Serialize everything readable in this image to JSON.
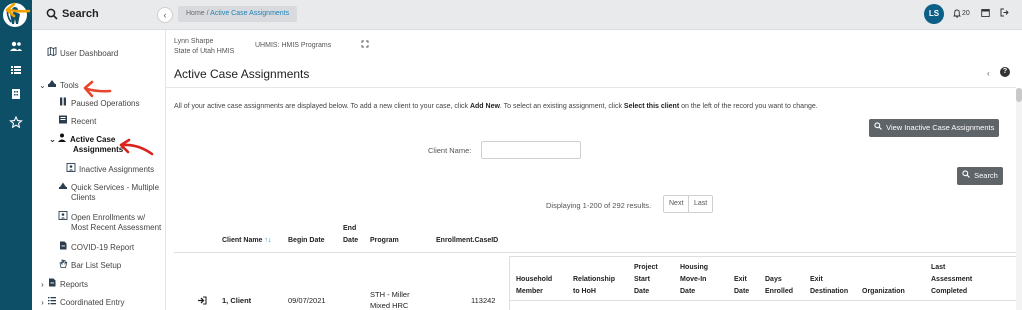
{
  "sidebar": {
    "search_label": "Search",
    "items": [
      {
        "label": "User Dashboard",
        "icon": "map-icon"
      },
      {
        "label": "Tools",
        "icon": "tools-icon",
        "expand": "chevron-down"
      },
      {
        "label": "Paused Operations",
        "icon": "pause-icon"
      },
      {
        "label": "Recent",
        "icon": "recent-icon"
      },
      {
        "label_line1": "Active Case",
        "label_line2": "Assignments",
        "icon": "person-icon",
        "expand": "chevron-down"
      },
      {
        "label": "Inactive Assignments",
        "icon": "user-card-icon"
      },
      {
        "label_line1": "Quick Services - Multiple",
        "label_line2": "Clients",
        "icon": "quick-services-icon"
      },
      {
        "label_line1": "Open Enrollments w/",
        "label_line2": "Most Recent Assessment",
        "icon": "enrollments-icon"
      },
      {
        "label": "COVID-19 Report",
        "icon": "report-icon"
      },
      {
        "label": "Bar List Setup",
        "icon": "hand-icon"
      },
      {
        "label": "Reports",
        "icon": "reports-icon",
        "expand": "chevron-right"
      },
      {
        "label": "Coordinated Entry",
        "icon": "list-icon",
        "expand": "chevron-right"
      }
    ]
  },
  "topbar": {
    "breadcrumb_home": "Home",
    "breadcrumb_sep": "/",
    "breadcrumb_current": "Active Case Assignments",
    "avatar_initials": "LS",
    "notification_count": "20"
  },
  "subheader": {
    "user_name": "Lynn Sharpe",
    "org_name": "State of Utah HMIS",
    "program": "UHMIS: HMIS Programs"
  },
  "page": {
    "title": "Active Case Assignments",
    "intro_part1": "All of your active case assignments are displayed below. To add a new client to your case, click ",
    "intro_bold1": "Add New",
    "intro_part2": ". To select an existing assignment, click ",
    "intro_bold2": "Select this client",
    "intro_part3": " on the left of the record you want to change.",
    "view_inactive_button": "View Inactive Case Assignments",
    "client_name_label": "Client Name:",
    "client_name_value": "",
    "search_button": "Search",
    "displaying_text": "Displaying 1-200 of 292 results.",
    "next_button": "Next",
    "last_button": "Last"
  },
  "table": {
    "columns": {
      "client_name": "Client Name",
      "begin_date": "Begin Date",
      "end_date_1": "End",
      "end_date_2": "Date",
      "program": "Program",
      "enrollment_case_id": "Enrollment.CaseID"
    },
    "inner_columns": {
      "household_1": "Household",
      "household_2": "Member",
      "relationship_1": "Relationship",
      "relationship_2": "to HoH",
      "project_1": "Project",
      "project_2": "Start",
      "project_3": "Date",
      "housing_1": "Housing",
      "housing_2": "Move-In",
      "housing_3": "Date",
      "exit_date_1": "Exit",
      "exit_date_2": "Date",
      "days_1": "Days",
      "days_2": "Enrolled",
      "exit_dest_1": "Exit",
      "exit_dest_2": "Destination",
      "organization": "Organization",
      "last_1": "Last",
      "last_2": "Assessment",
      "last_3": "Completed"
    },
    "rows": [
      {
        "client_name": "1, Client",
        "begin_date": "09/07/2021",
        "program_line1": "STH - Miller",
        "program_line2": "Mixed HRC",
        "case_id": "113242"
      }
    ]
  },
  "colors": {
    "rail": "#0c4f67",
    "avatar": "#0c5f86",
    "accent": "#1d83b7",
    "annotation_orange": "#f2a200",
    "annotation_red": "#e8452c",
    "annotation_dark_red": "#d9231b"
  }
}
